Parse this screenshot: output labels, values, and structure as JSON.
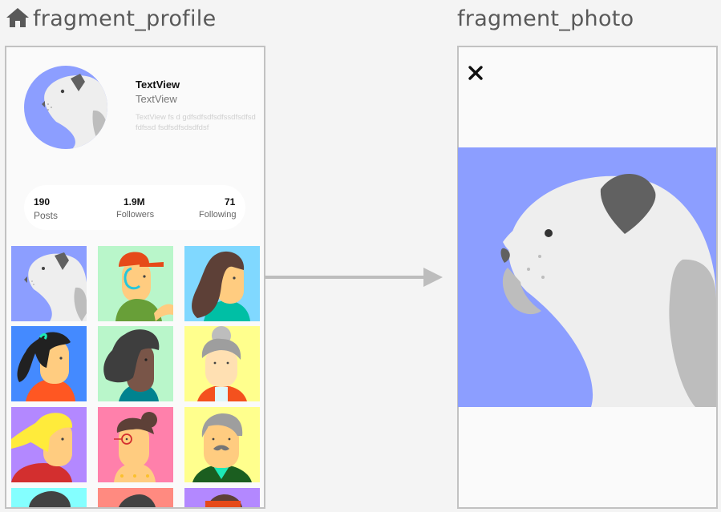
{
  "screens": {
    "profile_label": "fragment_profile",
    "photo_label": "fragment_photo"
  },
  "profile": {
    "title": "TextView",
    "subtitle": "TextView",
    "description": "TextView fs d gdfsdfsdfsdfssdfsdfsdfdfssd fsdfsdfsdsdfdsf",
    "stats": [
      {
        "value": "190",
        "label": "Posts"
      },
      {
        "value": "1.9M",
        "label": "Followers"
      },
      {
        "value": "71",
        "label": "Following"
      }
    ],
    "grid": [
      {
        "name": "dog",
        "bg": "#8c9eff"
      },
      {
        "name": "cap-man",
        "bg": "#b9f6ca"
      },
      {
        "name": "long-hair-woman",
        "bg": "#80d8ff"
      },
      {
        "name": "ponytail-woman",
        "bg": "#448aff"
      },
      {
        "name": "curly-woman",
        "bg": "#b9f6ca"
      },
      {
        "name": "bun-elder-woman",
        "bg": "#ffff8d"
      },
      {
        "name": "blonde-woman",
        "bg": "#b388ff"
      },
      {
        "name": "glasses-woman",
        "bg": "#ff80ab"
      },
      {
        "name": "mustache-man",
        "bg": "#ffff8d"
      },
      {
        "name": "partial-tile-1",
        "bg": "#84ffff"
      },
      {
        "name": "partial-tile-2",
        "bg": "#ff8a80"
      },
      {
        "name": "partial-tile-3",
        "bg": "#b388ff"
      }
    ]
  },
  "photo": {
    "close_icon": "close-icon",
    "image": "dog",
    "bg": "#8c9eff"
  },
  "colors": {
    "page_bg": "#f4f4f4",
    "panel_border": "#c2c2c2",
    "arrow": "#bdbdbd",
    "label": "#595959"
  }
}
